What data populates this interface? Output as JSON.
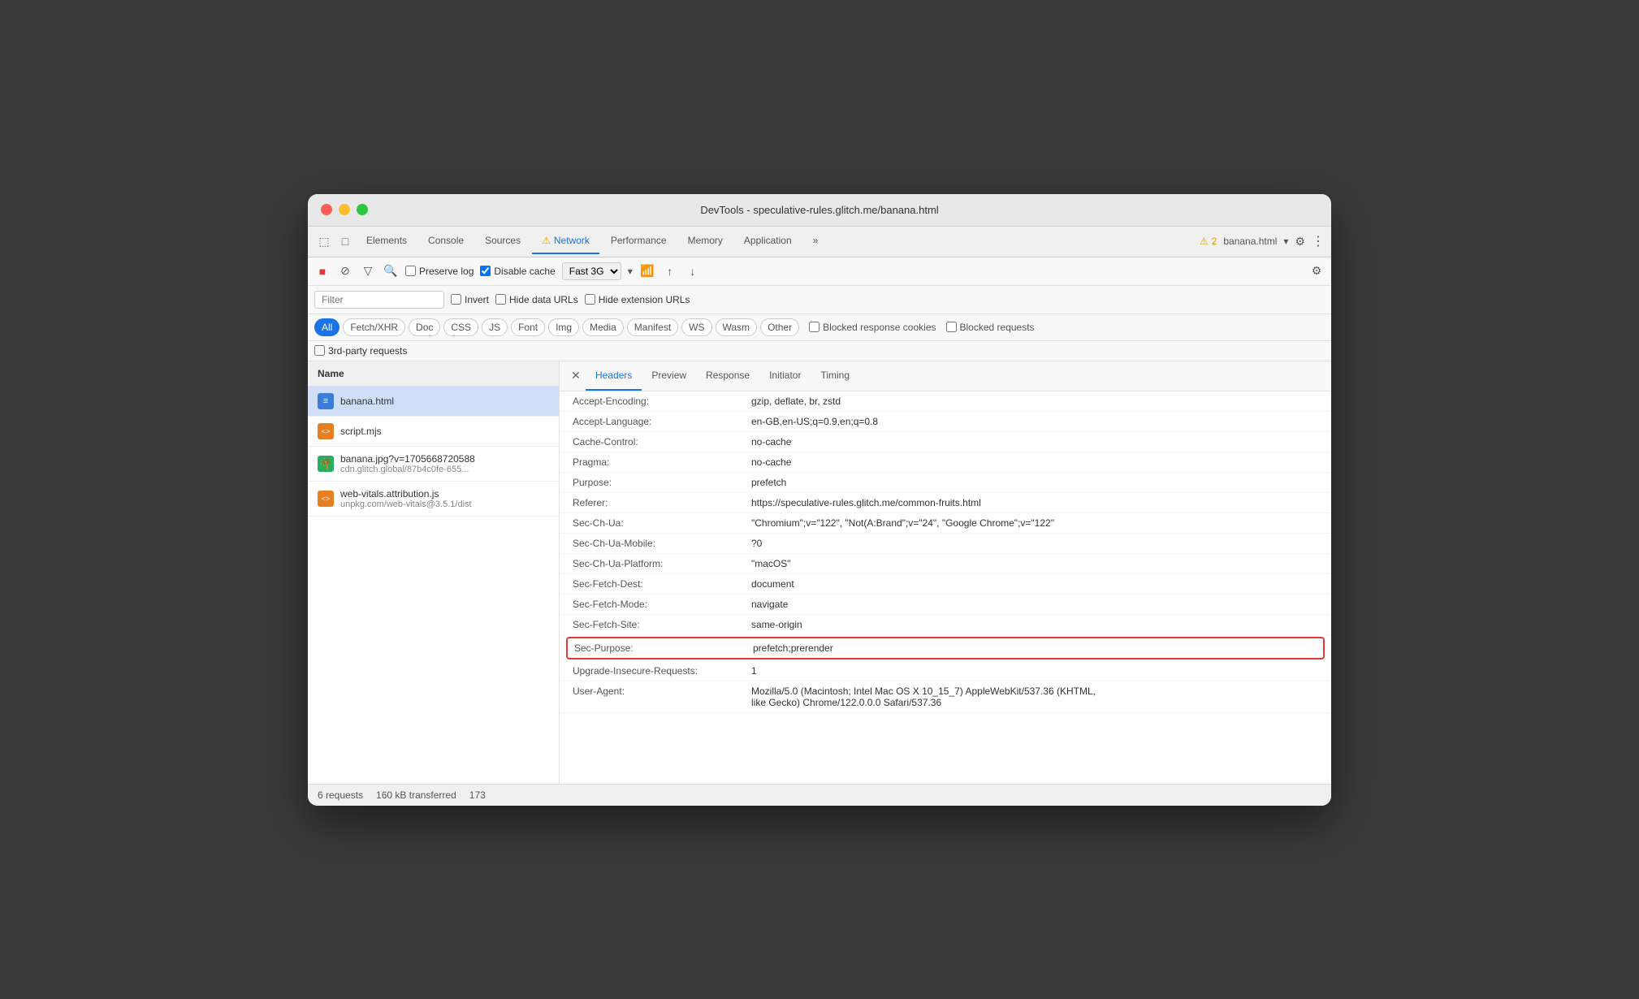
{
  "window": {
    "title": "DevTools - speculative-rules.glitch.me/banana.html"
  },
  "traffic_lights": {
    "close": "●",
    "minimize": "●",
    "maximize": "●"
  },
  "devtools_tabs": {
    "icons": [
      "⬚",
      "□"
    ],
    "tabs": [
      {
        "label": "Elements",
        "active": false
      },
      {
        "label": "Console",
        "active": false
      },
      {
        "label": "Sources",
        "active": false
      },
      {
        "label": "Network",
        "active": true,
        "warning": true
      },
      {
        "label": "Performance",
        "active": false
      },
      {
        "label": "Memory",
        "active": false
      },
      {
        "label": "Application",
        "active": false
      },
      {
        "label": "»",
        "active": false
      }
    ],
    "right": {
      "warning_count": "2",
      "page_label": "banana.html",
      "settings_icon": "⚙",
      "more_icon": "⋮"
    }
  },
  "toolbar": {
    "stop_icon": "■",
    "clear_icon": "🚫",
    "filter_icon": "▼",
    "search_icon": "🔍",
    "preserve_log_label": "Preserve log",
    "disable_cache_label": "Disable cache",
    "disable_cache_checked": true,
    "speed_label": "Fast 3G",
    "upload_icon": "↑",
    "download_icon": "↓",
    "settings_icon": "⚙"
  },
  "filter_bar": {
    "placeholder": "Filter",
    "invert_label": "Invert",
    "hide_data_urls_label": "Hide data URLs",
    "hide_extension_urls_label": "Hide extension URLs"
  },
  "filter_chips": {
    "chips": [
      {
        "label": "All",
        "active": true
      },
      {
        "label": "Fetch/XHR",
        "active": false
      },
      {
        "label": "Doc",
        "active": false
      },
      {
        "label": "CSS",
        "active": false
      },
      {
        "label": "JS",
        "active": false
      },
      {
        "label": "Font",
        "active": false
      },
      {
        "label": "Img",
        "active": false
      },
      {
        "label": "Media",
        "active": false
      },
      {
        "label": "Manifest",
        "active": false
      },
      {
        "label": "WS",
        "active": false
      },
      {
        "label": "Wasm",
        "active": false
      },
      {
        "label": "Other",
        "active": false
      }
    ],
    "blocked_response_cookies_label": "Blocked response cookies",
    "blocked_requests_label": "Blocked requests"
  },
  "third_party": {
    "label": "3rd-party requests"
  },
  "file_panel": {
    "header": "Name",
    "files": [
      {
        "name": "banana.html",
        "subtitle": "",
        "icon_type": "html",
        "icon_text": "≡",
        "selected": true
      },
      {
        "name": "script.mjs",
        "subtitle": "",
        "icon_type": "js",
        "icon_text": "<>",
        "selected": false
      },
      {
        "name": "banana.jpg?v=1705668720588",
        "subtitle": "cdn.glitch.global/87b4c0fe-655...",
        "icon_type": "img",
        "icon_text": "🌴",
        "selected": false
      },
      {
        "name": "web-vitals.attribution.js",
        "subtitle": "unpkg.com/web-vitals@3.5.1/dist",
        "icon_type": "js",
        "icon_text": "<>",
        "selected": false
      }
    ]
  },
  "detail_panel": {
    "close_icon": "✕",
    "tabs": [
      {
        "label": "Headers",
        "active": true
      },
      {
        "label": "Preview",
        "active": false
      },
      {
        "label": "Response",
        "active": false
      },
      {
        "label": "Initiator",
        "active": false
      },
      {
        "label": "Timing",
        "active": false
      }
    ],
    "headers": [
      {
        "name": "Accept-Encoding:",
        "value": "gzip, deflate, br, zstd",
        "highlighted": false
      },
      {
        "name": "Accept-Language:",
        "value": "en-GB,en-US;q=0.9,en;q=0.8",
        "highlighted": false
      },
      {
        "name": "Cache-Control:",
        "value": "no-cache",
        "highlighted": false
      },
      {
        "name": "Pragma:",
        "value": "no-cache",
        "highlighted": false
      },
      {
        "name": "Purpose:",
        "value": "prefetch",
        "highlighted": false
      },
      {
        "name": "Referer:",
        "value": "https://speculative-rules.glitch.me/common-fruits.html",
        "highlighted": false
      },
      {
        "name": "Sec-Ch-Ua:",
        "value": "\"Chromium\";v=\"122\", \"Not(A:Brand\";v=\"24\", \"Google Chrome\";v=\"122\"",
        "highlighted": false
      },
      {
        "name": "Sec-Ch-Ua-Mobile:",
        "value": "?0",
        "highlighted": false
      },
      {
        "name": "Sec-Ch-Ua-Platform:",
        "value": "\"macOS\"",
        "highlighted": false
      },
      {
        "name": "Sec-Fetch-Dest:",
        "value": "document",
        "highlighted": false
      },
      {
        "name": "Sec-Fetch-Mode:",
        "value": "navigate",
        "highlighted": false
      },
      {
        "name": "Sec-Fetch-Site:",
        "value": "same-origin",
        "highlighted": false
      },
      {
        "name": "Sec-Purpose:",
        "value": "prefetch;prerender",
        "highlighted": true
      },
      {
        "name": "Upgrade-Insecure-Requests:",
        "value": "1",
        "highlighted": false
      },
      {
        "name": "User-Agent:",
        "value": "Mozilla/5.0 (Macintosh; Intel Mac OS X 10_15_7) AppleWebKit/537.36 (KHTML, like Gecko) Chrome/122.0.0.0 Safari/537.36",
        "highlighted": false
      }
    ]
  },
  "status_bar": {
    "requests": "6 requests",
    "transferred": "160 kB transferred",
    "extra": "173"
  }
}
